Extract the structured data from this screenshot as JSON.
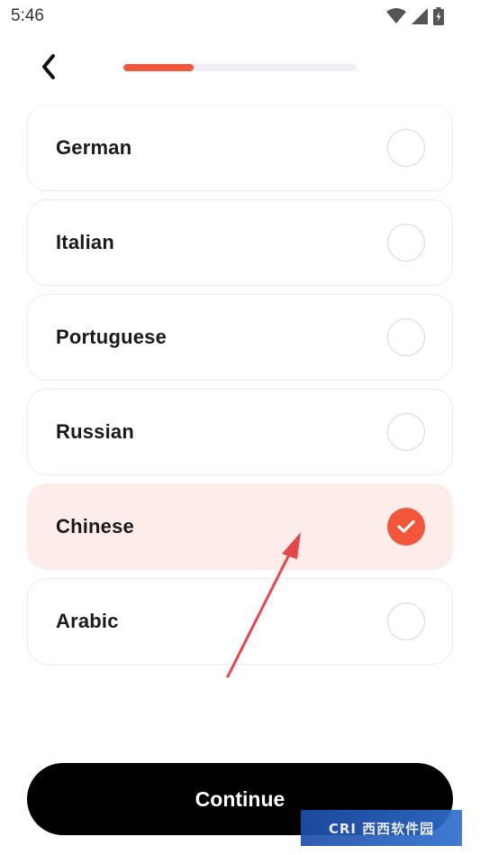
{
  "status_bar": {
    "time": "5:46",
    "icons": [
      "wifi-icon",
      "cellular-signal-icon",
      "battery-icon"
    ]
  },
  "header": {
    "back_icon": "chevron-left-icon",
    "progress": 0.3
  },
  "languages": [
    {
      "label": "German",
      "selected": false
    },
    {
      "label": "Italian",
      "selected": false
    },
    {
      "label": "Portuguese",
      "selected": false
    },
    {
      "label": "Russian",
      "selected": false
    },
    {
      "label": "Chinese",
      "selected": true
    },
    {
      "label": "Arabic",
      "selected": false
    }
  ],
  "continue_label": "Continue",
  "watermark": {
    "text": "CRI 西西软件园"
  },
  "colors": {
    "accent": "#f2573c",
    "selected_bg": "#fdedea",
    "button": "#000000",
    "annotation_arrow": "#e8474a"
  }
}
